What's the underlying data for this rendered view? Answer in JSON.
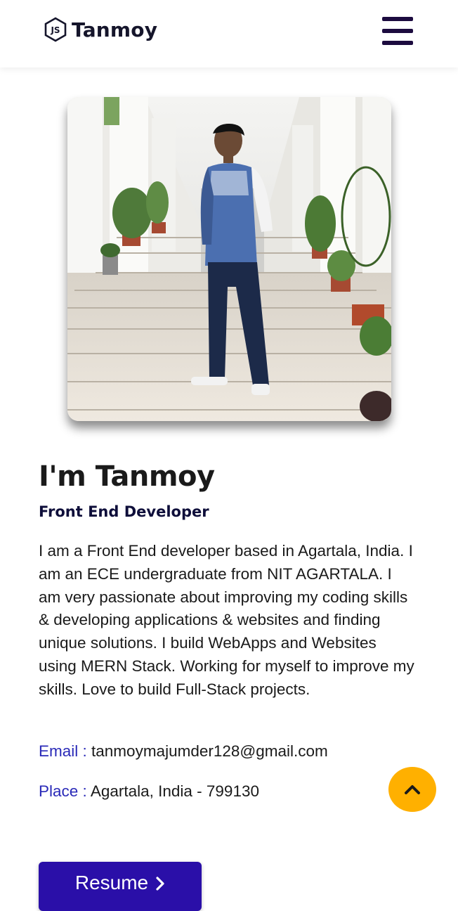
{
  "navbar": {
    "brand_name": "Tanmoy",
    "logo_icon": "nodejs-hexagon-icon",
    "menu_icon": "hamburger-menu-icon"
  },
  "hero": {
    "photo_alt": "Tanmoy standing on stairs"
  },
  "about": {
    "title": "I'm Tanmoy",
    "role": "Front End Developer",
    "bio": "I am a Front End developer based in Agartala, India. I am an ECE undergraduate from NIT AGARTALA. I am very passionate about improving my coding skills & developing applications & websites and finding unique solutions. I build WebApps and Websites using MERN Stack. Working for myself to improve my skills. Love to build Full-Stack projects.",
    "email_label": "Email :",
    "email_value": "tanmoymajumder128@gmail.com",
    "place_label": "Place :",
    "place_value": "Agartala, India - 799130"
  },
  "actions": {
    "resume_label": "Resume",
    "resume_icon": "chevron-right-icon",
    "scroll_top_icon": "chevron-up-icon"
  },
  "colors": {
    "accent": "#2a0fa8",
    "scroll_button": "#ffb000",
    "label_blue": "#2a2ab8",
    "menu": "#1c0b3f"
  }
}
